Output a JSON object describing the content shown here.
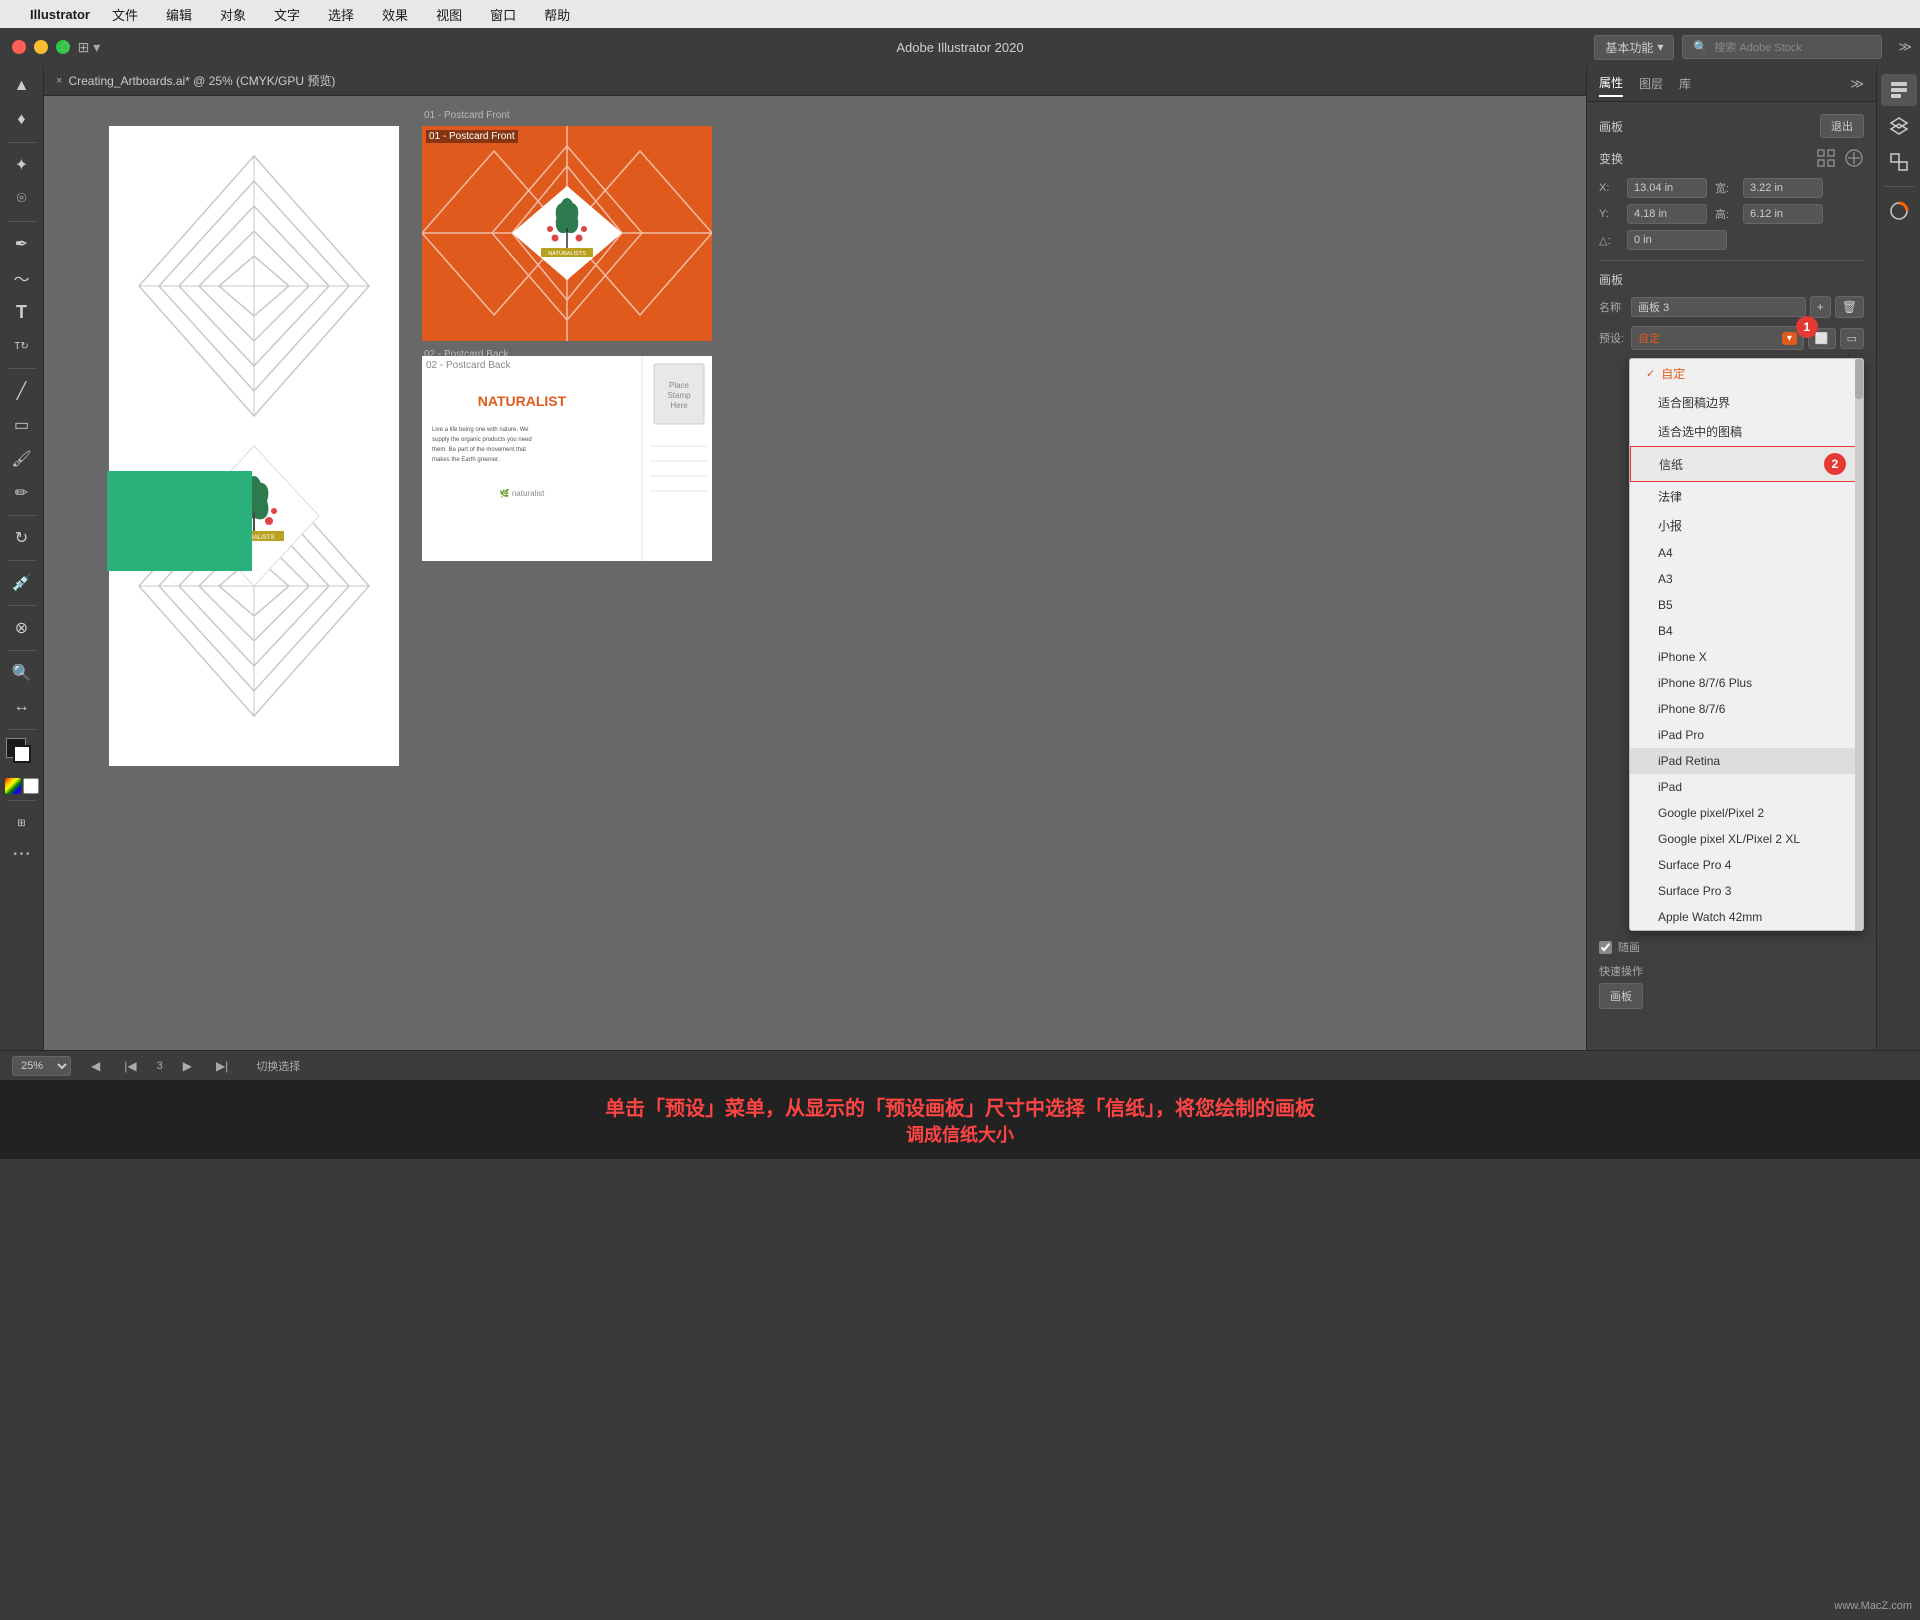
{
  "menubar": {
    "apple": "",
    "app_name": "Illustrator",
    "menus": [
      "文件",
      "编辑",
      "对象",
      "文字",
      "选择",
      "效果",
      "视图",
      "窗口",
      "帮助"
    ]
  },
  "titlebar": {
    "title": "Adobe Illustrator 2020",
    "workspace_label": "基本功能",
    "search_placeholder": "搜索 Adobe Stock"
  },
  "tab": {
    "close": "×",
    "title": "Creating_Artboards.ai* @ 25% (CMYK/GPU 预览)"
  },
  "canvas": {
    "artboard1_label": "",
    "artboard2_label": "01 - Postcard Front",
    "artboard3_label": "02 - Postcard Back"
  },
  "properties": {
    "panel_title": "画板",
    "exit_btn": "退出",
    "transform_label": "变换",
    "x_label": "X:",
    "x_value": "13.04 in",
    "y_label": "Y:",
    "y_value": "4.18 in",
    "w_label": "宽:",
    "w_value": "3.22 in",
    "h_label": "高:",
    "h_value": "6.12 in",
    "angle_label": "△:",
    "angle_value": "0 in",
    "artboard_section": "画板",
    "name_label": "名称",
    "name_value": "画板 3",
    "preset_label": "预设:",
    "preset_value": "自定",
    "checkbox_label": "随画"
  },
  "tabs": {
    "properties": "属性",
    "layers": "图层",
    "library": "库"
  },
  "dropdown": {
    "items": [
      {
        "label": "✓ 自定",
        "active": true,
        "highlighted": false
      },
      {
        "label": "适合图稿边界",
        "active": false,
        "highlighted": false
      },
      {
        "label": "适合选中的图稿",
        "active": false,
        "highlighted": false
      },
      {
        "label": "信纸",
        "active": false,
        "highlighted": true
      },
      {
        "label": "法律",
        "active": false,
        "highlighted": false
      },
      {
        "label": "小报",
        "active": false,
        "highlighted": false
      },
      {
        "label": "A4",
        "active": false,
        "highlighted": false
      },
      {
        "label": "A3",
        "active": false,
        "highlighted": false
      },
      {
        "label": "B5",
        "active": false,
        "highlighted": false
      },
      {
        "label": "B4",
        "active": false,
        "highlighted": false
      },
      {
        "label": "iPhone X",
        "active": false,
        "highlighted": false
      },
      {
        "label": "iPhone 8/7/6 Plus",
        "active": false,
        "highlighted": false
      },
      {
        "label": "iPhone 8/7/6",
        "active": false,
        "highlighted": false
      },
      {
        "label": "iPad Pro",
        "active": false,
        "highlighted": false
      },
      {
        "label": "iPad Retina",
        "active": false,
        "highlighted": false
      },
      {
        "label": "iPad",
        "active": false,
        "highlighted": false
      },
      {
        "label": "Google pixel/Pixel 2",
        "active": false,
        "highlighted": false
      },
      {
        "label": "Google pixel XL/Pixel 2 XL",
        "active": false,
        "highlighted": false
      },
      {
        "label": "Surface Pro 4",
        "active": false,
        "highlighted": false
      },
      {
        "label": "Surface Pro 3",
        "active": false,
        "highlighted": false
      },
      {
        "label": "Apple Watch 42mm",
        "active": false,
        "highlighted": false
      }
    ]
  },
  "status_bar": {
    "zoom": "25%",
    "page_nav": "3",
    "status": "切换选择"
  },
  "instruction": {
    "line1": "单击「预设」菜单，从显示的「预设画板」尺寸中选择「信纸」，将您绘制的画板",
    "line2": "调成信纸大小"
  },
  "watermark": "www.MacZ.com",
  "badges": {
    "one": "1",
    "two": "2"
  }
}
